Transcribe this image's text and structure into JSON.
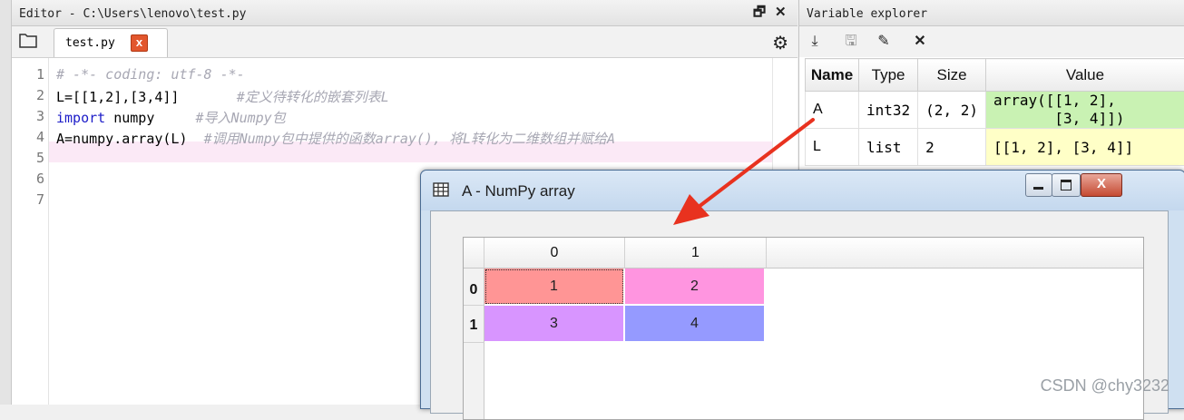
{
  "editor": {
    "title": "Editor - C:\\Users\\lenovo\\test.py",
    "undock_icon": "undock-icon",
    "close_icon": "close-icon",
    "tab": {
      "label": "test.py",
      "close_glyph": "x"
    },
    "gear_icon": "gear-icon",
    "line_numbers": [
      "1",
      "2",
      "3",
      "4",
      "5",
      "6",
      "7"
    ],
    "lines": [
      {
        "parts": [
          {
            "t": "# -*- coding: utf-8 -*-",
            "c": "cm"
          }
        ]
      },
      {
        "parts": [
          {
            "t": "L=[[1,2],[3,4]]       ",
            "c": ""
          },
          {
            "t": "#定义待转化的嵌套列表L",
            "c": "cm"
          }
        ]
      },
      {
        "parts": [
          {
            "t": "import",
            "c": "kw"
          },
          {
            "t": " numpy     ",
            "c": ""
          },
          {
            "t": "#导入Numpy包",
            "c": "cm"
          }
        ]
      },
      {
        "parts": [
          {
            "t": "A=numpy.array(L)  ",
            "c": ""
          },
          {
            "t": "#调用Numpy包中提供的函数array(), 将L转化为二维数组并赋给A",
            "c": "cm"
          }
        ]
      },
      {
        "parts": []
      },
      {
        "parts": []
      },
      {
        "parts": []
      }
    ]
  },
  "variable_explorer": {
    "title": "Variable explorer",
    "toolbar_icons": [
      "import-data-icon",
      "save-data-icon",
      "save-as-icon",
      "remove-all-icon"
    ],
    "columns": [
      "Name",
      "Type",
      "Size",
      "Value"
    ],
    "rows": [
      {
        "name": "A",
        "type": "int32",
        "size": "(2, 2)",
        "value": "array([[1, 2],\n       [3, 4]])"
      },
      {
        "name": "L",
        "type": "list",
        "size": "2",
        "value": "[[1, 2], [3, 4]]"
      }
    ]
  },
  "array_dialog": {
    "title": "A - NumPy array",
    "close_glyph": "X",
    "col_headers": [
      "0",
      "1"
    ],
    "row_headers": [
      "0",
      "1"
    ],
    "cells": [
      [
        "1",
        "2"
      ],
      [
        "3",
        "4"
      ]
    ],
    "cell_colors": [
      [
        "#ff9595",
        "#ff95e0"
      ],
      [
        "#d895ff",
        "#959aff"
      ]
    ]
  },
  "watermark": "CSDN @chy3232"
}
